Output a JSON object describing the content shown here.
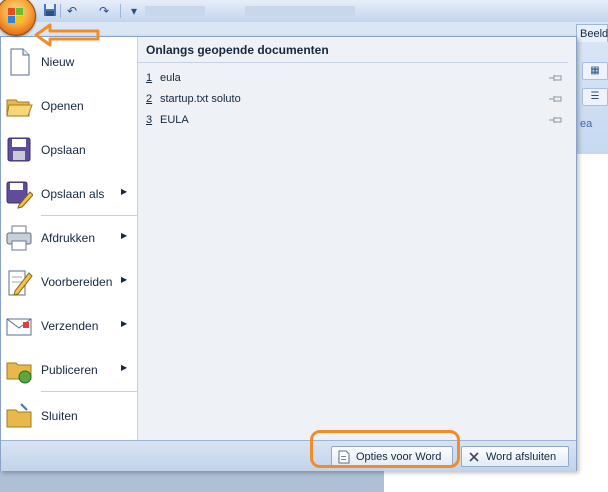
{
  "window": {
    "tab_beeld": "Beeld",
    "ribbon_group_label": "ea"
  },
  "quick_access": {
    "icons": [
      "save-icon",
      "undo-icon",
      "redo-icon",
      "customize-icon"
    ]
  },
  "office_menu": {
    "commands": [
      {
        "label": "Nieuw",
        "icon": "new-document-icon",
        "submenu": false
      },
      {
        "label": "Openen",
        "icon": "open-folder-icon",
        "submenu": false
      },
      {
        "label": "Opslaan",
        "icon": "save-disk-icon",
        "submenu": false
      },
      {
        "label": "Opslaan als",
        "icon": "save-as-icon",
        "submenu": true
      },
      {
        "label": "Afdrukken",
        "icon": "printer-icon",
        "submenu": true
      },
      {
        "label": "Voorbereiden",
        "icon": "prepare-icon",
        "submenu": true
      },
      {
        "label": "Verzenden",
        "icon": "send-icon",
        "submenu": true
      },
      {
        "label": "Publiceren",
        "icon": "publish-icon",
        "submenu": true
      },
      {
        "label": "Sluiten",
        "icon": "close-folder-icon",
        "submenu": false
      }
    ],
    "recent": {
      "header": "Onlangs geopende documenten",
      "items": [
        {
          "num": "1",
          "name": "eula"
        },
        {
          "num": "2",
          "name": "startup.txt soluto"
        },
        {
          "num": "3",
          "name": "EULA"
        }
      ]
    },
    "options_button": "Opties voor Word",
    "exit_button": "Word afsluiten"
  },
  "colors": {
    "annotation": "#f28c28",
    "menu_border": "#8aa2c8",
    "recent_bg": "#eef1f5"
  }
}
